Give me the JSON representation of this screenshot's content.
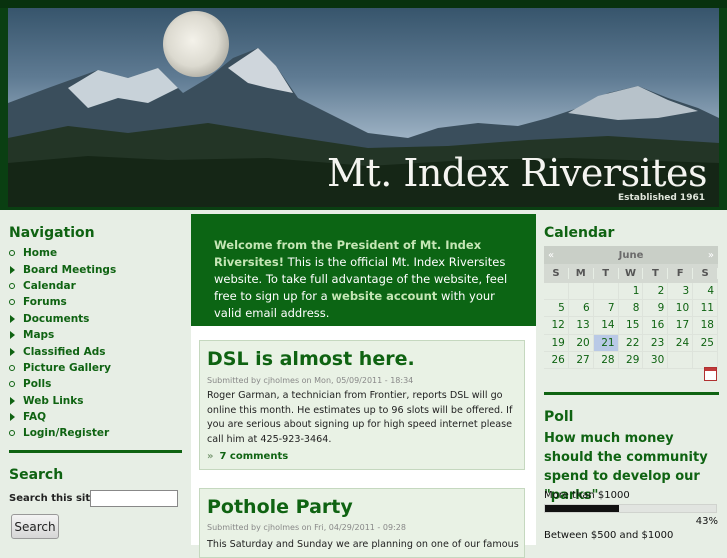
{
  "header": {
    "site_title": "Mt. Index Riversites",
    "established": "Established 1961"
  },
  "navigation": {
    "title": "Navigation",
    "items": [
      {
        "label": "Home",
        "type": "leaf"
      },
      {
        "label": "Board Meetings",
        "type": "collapsed"
      },
      {
        "label": "Calendar",
        "type": "leaf"
      },
      {
        "label": "Forums",
        "type": "leaf"
      },
      {
        "label": "Documents",
        "type": "collapsed"
      },
      {
        "label": "Maps",
        "type": "collapsed"
      },
      {
        "label": "Classified Ads",
        "type": "collapsed"
      },
      {
        "label": "Picture Gallery",
        "type": "leaf"
      },
      {
        "label": "Polls",
        "type": "leaf"
      },
      {
        "label": "Web Links",
        "type": "collapsed"
      },
      {
        "label": "FAQ",
        "type": "collapsed"
      },
      {
        "label": "Login/Register",
        "type": "leaf"
      }
    ]
  },
  "search": {
    "title": "Search",
    "label": "Search this site:",
    "value": "",
    "button": "Search"
  },
  "welcome": {
    "heading": "Welcome from the President of Mt. Index Riversites!",
    "text_1": "This is the official Mt. Index Riversites website. To take full advantage of the website, feel free to sign up for a",
    "link": "website account",
    "text_2": "with your valid email address."
  },
  "posts": [
    {
      "title": "DSL is almost here.",
      "meta": "Submitted by cjholmes on Mon, 05/09/2011 - 18:34",
      "body": "Roger Garman, a technician from Frontier, reports DSL will go online this month.  He estimates up to 96 slots will be offered.  If you are serious about signing up for high speed internet please call him at 425-923-3464.",
      "comments": "7 comments"
    },
    {
      "title": "Pothole Party",
      "meta": "Submitted by cjholmes on Fri, 04/29/2011 - 09:28",
      "body": "This Saturday and Sunday we are planning on one of our famous"
    }
  ],
  "calendar": {
    "title": "Calendar",
    "prev": "«",
    "month": "June",
    "next": "»",
    "weekdays": [
      "S",
      "M",
      "T",
      "W",
      "T",
      "F",
      "S"
    ],
    "weeks": [
      [
        "",
        "",
        "",
        "1",
        "2",
        "3",
        "4"
      ],
      [
        "5",
        "6",
        "7",
        "8",
        "9",
        "10",
        "11"
      ],
      [
        "12",
        "13",
        "14",
        "15",
        "16",
        "17",
        "18"
      ],
      [
        "19",
        "20",
        "21",
        "22",
        "23",
        "24",
        "25"
      ],
      [
        "26",
        "27",
        "28",
        "29",
        "30",
        "",
        ""
      ]
    ],
    "today": "21"
  },
  "poll": {
    "title": "Poll",
    "question": "How much money should the community spend to develop our \"parks\"",
    "choices": [
      {
        "label": "More than $1000",
        "percent_text": "43%",
        "fraction": 0.43
      },
      {
        "label": "Between $500 and $1000"
      }
    ]
  },
  "colors": {
    "accent_green": "#0f6312",
    "header_dark": "#0a3f12",
    "welcome_bg": "#0c6514",
    "today_highlight": "#b9c9e6"
  }
}
